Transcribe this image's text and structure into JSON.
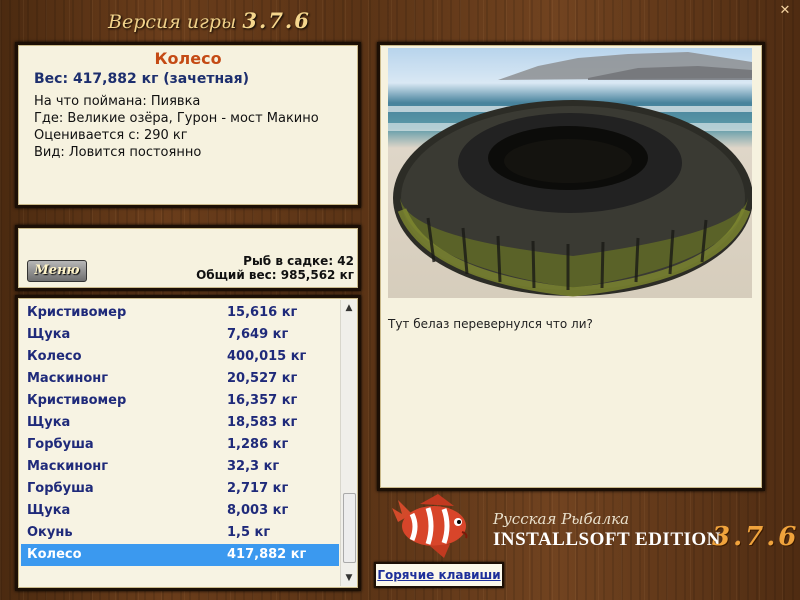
{
  "version_title": {
    "prefix": "Версия игры",
    "number": "3.7.6"
  },
  "close_glyph": "✕",
  "info": {
    "fish_name": "Колесо",
    "weight_line": "Вес: 417,882 кг (зачетная)",
    "bait_line": "На что поймана: Пиявка",
    "place_line": "Где: Великие озёра, Гурон - мост Макино",
    "score_line": "Оценивается с: 290 кг",
    "type_line": "Вид: Ловится постоянно"
  },
  "keepnet": {
    "menu_label": "Меню",
    "fish_count_line": "Рыб в садке: 42",
    "total_weight_line": "Общий вес: 985,562 кг"
  },
  "catch_list": [
    {
      "name": "Кристивомер",
      "weight": "15,616 кг"
    },
    {
      "name": "Щука",
      "weight": "7,649 кг"
    },
    {
      "name": "Колесо",
      "weight": "400,015 кг"
    },
    {
      "name": "Маскинонг",
      "weight": "20,527 кг"
    },
    {
      "name": "Кристивомер",
      "weight": "16,357 кг"
    },
    {
      "name": "Щука",
      "weight": "18,583 кг"
    },
    {
      "name": "Горбуша",
      "weight": "1,286 кг"
    },
    {
      "name": "Маскинонг",
      "weight": "32,3 кг"
    },
    {
      "name": "Горбуша",
      "weight": "2,717 кг"
    },
    {
      "name": "Щука",
      "weight": "8,003 кг"
    },
    {
      "name": "Окунь",
      "weight": "1,5 кг"
    },
    {
      "name": "Колесо",
      "weight": "417,882 кг"
    }
  ],
  "selected_index": 11,
  "photo": {
    "subject": "tire-on-beach-photo",
    "comment": "Тут белаз перевернулся что ли?"
  },
  "logo": {
    "title": "Русская Рыбалка",
    "edition": "INSTALLSOFT EDITION",
    "version": "3.7.6",
    "icon": "fish-logo-icon"
  },
  "hotkeys_label": "Горячие клавиши",
  "colors": {
    "fish_name": "#c44a14",
    "weight": "#1d2f6e",
    "list_text": "#1f2a7a",
    "selected_row": "#3b99ef",
    "wood": "#5a3417"
  }
}
